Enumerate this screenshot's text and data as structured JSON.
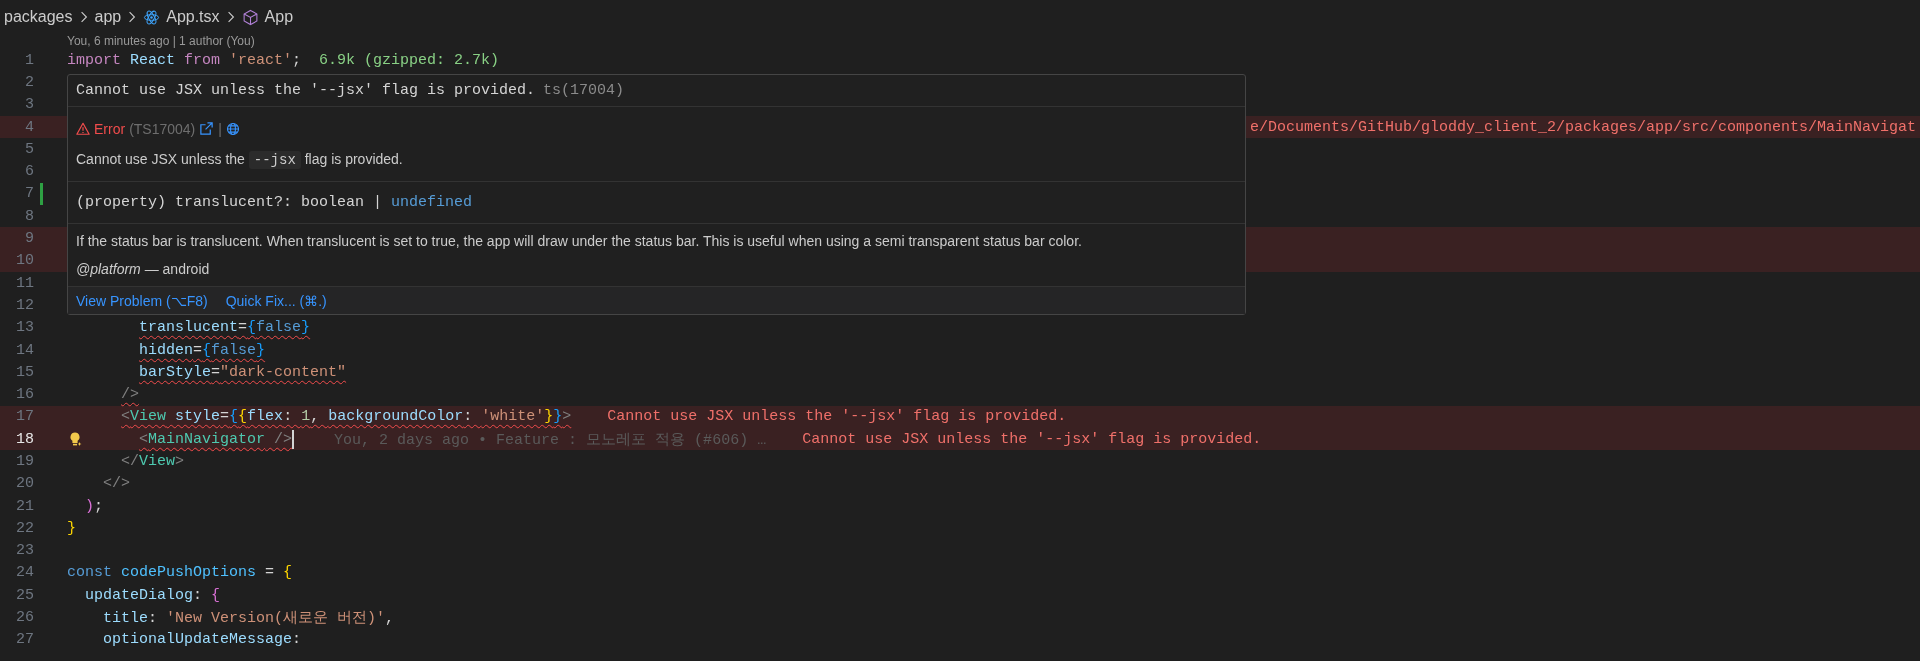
{
  "breadcrumbs": [
    {
      "label": "packages",
      "kind": "folder"
    },
    {
      "label": "app",
      "kind": "folder"
    },
    {
      "label": "App.tsx",
      "kind": "react"
    },
    {
      "label": "App",
      "kind": "symbol"
    }
  ],
  "blame_header": "You, 6 minutes ago | 1 author (You)",
  "lines": [
    {
      "number": "1",
      "tokens": [
        {
          "t": "import",
          "kind": "kw"
        },
        {
          "t": " React",
          "kind": "var"
        },
        {
          "t": " from",
          "kind": "kw"
        },
        {
          "t": " 'react'",
          "kind": "str"
        },
        {
          "t": ";",
          "kind": "plain"
        }
      ],
      "hint": "6.9k (gzipped: 2.7k)"
    },
    {
      "number": "2"
    },
    {
      "number": "3"
    },
    {
      "number": "4",
      "error": true,
      "tail": "e/Documents/GitHub/gloddy_client_2/packages/app/src/components/MainNavigat"
    },
    {
      "number": "5"
    },
    {
      "number": "6"
    },
    {
      "number": "7",
      "git_change": true
    },
    {
      "number": "8"
    },
    {
      "number": "9",
      "error": true
    },
    {
      "number": "10",
      "error": true
    },
    {
      "number": "11"
    },
    {
      "number": "12"
    },
    {
      "number": "13",
      "tokens": [
        {
          "t": "        translucent",
          "kind": "attr"
        },
        {
          "t": "=",
          "kind": "plain"
        },
        {
          "t": "{",
          "kind": "brace2"
        },
        {
          "t": "false",
          "kind": "const"
        },
        {
          "t": "}",
          "kind": "brace2"
        }
      ],
      "squiggle": true
    },
    {
      "number": "14",
      "tokens": [
        {
          "t": "        hidden",
          "kind": "attr"
        },
        {
          "t": "=",
          "kind": "plain"
        },
        {
          "t": "{",
          "kind": "brace2"
        },
        {
          "t": "false",
          "kind": "const"
        },
        {
          "t": "}",
          "kind": "brace2"
        }
      ],
      "squiggle": true
    },
    {
      "number": "15",
      "tokens": [
        {
          "t": "        barStyle",
          "kind": "attr"
        },
        {
          "t": "=",
          "kind": "plain"
        },
        {
          "t": "\"dark-content\"",
          "kind": "str"
        }
      ],
      "squiggle": true
    },
    {
      "number": "16",
      "tokens": [
        {
          "t": "      />",
          "kind": "punct"
        }
      ],
      "squiggle": true
    },
    {
      "number": "17",
      "tokens": [
        {
          "t": "      <",
          "kind": "punct"
        },
        {
          "t": "View",
          "kind": "tag"
        },
        {
          "t": " style",
          "kind": "attr"
        },
        {
          "t": "=",
          "kind": "plain"
        },
        {
          "t": "{",
          "kind": "brace2"
        },
        {
          "t": "{",
          "kind": "brace"
        },
        {
          "t": "flex",
          "kind": "attr"
        },
        {
          "t": ": ",
          "kind": "plain"
        },
        {
          "t": "1",
          "kind": "num"
        },
        {
          "t": ", ",
          "kind": "plain"
        },
        {
          "t": "backgroundColor",
          "kind": "attr"
        },
        {
          "t": ": ",
          "kind": "plain"
        },
        {
          "t": "'white'",
          "kind": "str"
        },
        {
          "t": "}",
          "kind": "brace"
        },
        {
          "t": "}",
          "kind": "brace2"
        },
        {
          "t": ">",
          "kind": "punct"
        }
      ],
      "squiggle": true,
      "error": true,
      "diagnostic": "Cannot use JSX unless the '--jsx' flag is provided."
    },
    {
      "number": "18",
      "tokens": [
        {
          "t": "        <",
          "kind": "punct"
        },
        {
          "t": "MainNavigator",
          "kind": "tag"
        },
        {
          "t": " />",
          "kind": "punct"
        }
      ],
      "squiggle": true,
      "error": true,
      "current": true,
      "lightbulb": true,
      "blame": "You, 2 days ago • Feature : 모노레포 적용 (#606) …",
      "diagnostic": "Cannot use JSX unless the '--jsx' flag is provided."
    },
    {
      "number": "19",
      "tokens": [
        {
          "t": "      </",
          "kind": "punct"
        },
        {
          "t": "View",
          "kind": "tag"
        },
        {
          "t": ">",
          "kind": "punct"
        }
      ]
    },
    {
      "number": "20",
      "tokens": [
        {
          "t": "    </>",
          "kind": "punct"
        }
      ]
    },
    {
      "number": "21",
      "tokens": [
        {
          "t": "  )",
          "kind": "brace3"
        },
        {
          "t": ";",
          "kind": "plain"
        }
      ]
    },
    {
      "number": "22",
      "tokens": [
        {
          "t": "}",
          "kind": "brace"
        }
      ]
    },
    {
      "number": "23"
    },
    {
      "number": "24",
      "tokens": [
        {
          "t": "const",
          "kind": "const"
        },
        {
          "t": " codePushOptions",
          "kind": "var2"
        },
        {
          "t": " = ",
          "kind": "plain"
        },
        {
          "t": "{",
          "kind": "brace"
        }
      ]
    },
    {
      "number": "25",
      "tokens": [
        {
          "t": "  updateDialog",
          "kind": "attr"
        },
        {
          "t": ": ",
          "kind": "plain"
        },
        {
          "t": "{",
          "kind": "brace3"
        }
      ]
    },
    {
      "number": "26",
      "tokens": [
        {
          "t": "    title",
          "kind": "attr"
        },
        {
          "t": ": ",
          "kind": "plain"
        },
        {
          "t": "'New Version(새로운 버전)'",
          "kind": "str"
        },
        {
          "t": ",",
          "kind": "plain"
        }
      ]
    },
    {
      "number": "27",
      "tokens": [
        {
          "t": "    optionalUpdateMessage",
          "kind": "attr"
        },
        {
          "t": ":",
          "kind": "plain"
        }
      ]
    }
  ],
  "hover": {
    "header": "Cannot use JSX unless the '--jsx' flag is provided.",
    "header_code": "ts(17004)",
    "severity": "Error",
    "error_code": "(TS17004)",
    "separator": "|",
    "message": {
      "before": "Cannot use JSX unless the",
      "code": "--jsx",
      "after": "flag is provided."
    },
    "signature": [
      {
        "t": "(property) translucent?: boolean | ",
        "kind": "sig"
      },
      {
        "t": "undefined",
        "kind": "const"
      }
    ],
    "doc": "If the status bar is translucent. When translucent is set to true, the app will draw under the status bar. This is useful when using a semi transparent status bar color.",
    "platform": "*@platform* — android",
    "actions": [
      "View Problem (⌥F8)",
      "Quick Fix... (⌘.)"
    ]
  }
}
